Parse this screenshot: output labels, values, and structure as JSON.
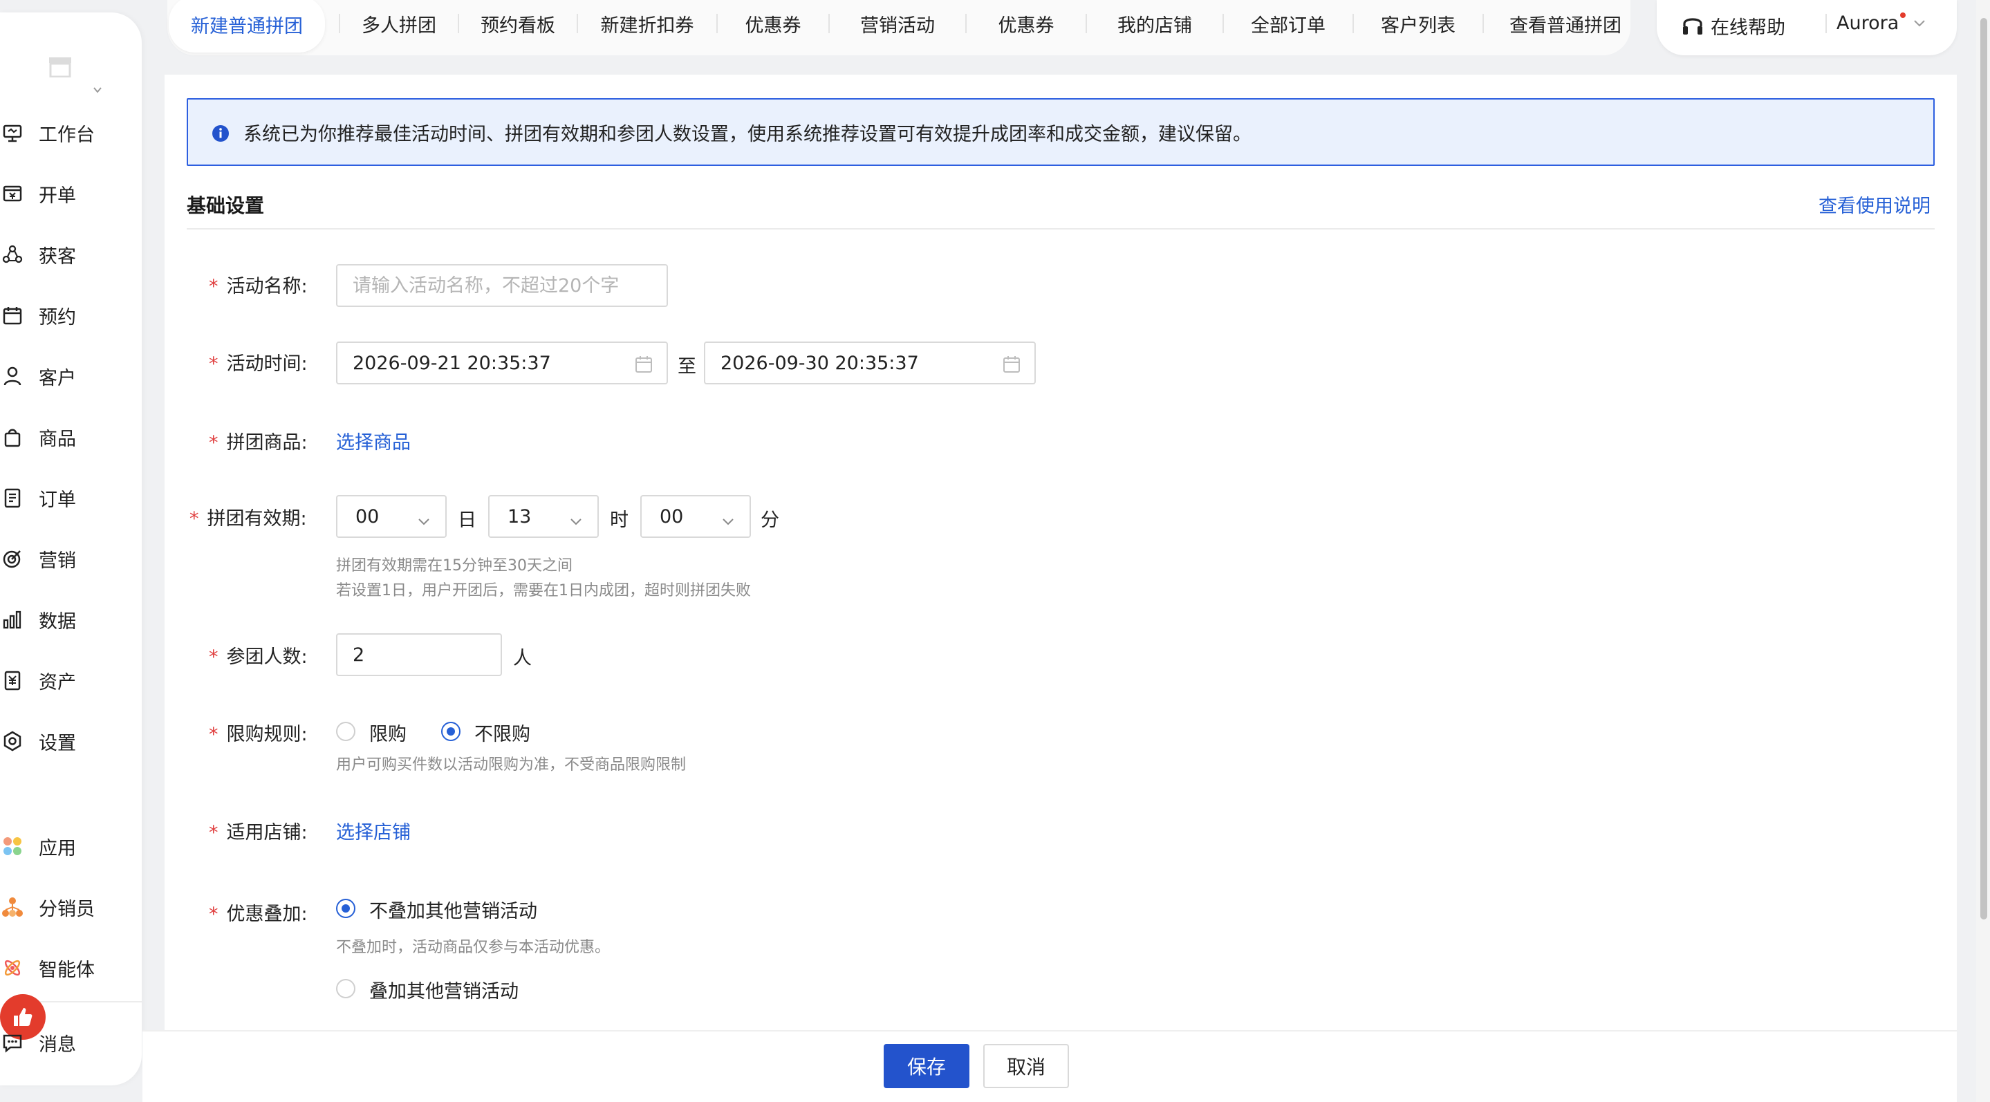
{
  "sidebar": {
    "items": [
      {
        "label": "工作台",
        "icon": "workbench-icon"
      },
      {
        "label": "开单",
        "icon": "billing-icon"
      },
      {
        "label": "获客",
        "icon": "acquire-icon"
      },
      {
        "label": "预约",
        "icon": "calendar-icon"
      },
      {
        "label": "客户",
        "icon": "user-icon"
      },
      {
        "label": "商品",
        "icon": "bag-icon"
      },
      {
        "label": "订单",
        "icon": "order-icon"
      },
      {
        "label": "营销",
        "icon": "target-icon"
      },
      {
        "label": "数据",
        "icon": "bar-chart-icon"
      },
      {
        "label": "资产",
        "icon": "asset-icon"
      },
      {
        "label": "设置",
        "icon": "gear-icon"
      }
    ],
    "apps": [
      {
        "label": "应用",
        "icon": "apps-icon"
      },
      {
        "label": "分销员",
        "icon": "distributor-icon"
      },
      {
        "label": "智能体",
        "icon": "agent-icon"
      }
    ],
    "message": {
      "label": "消息",
      "icon": "message-icon"
    }
  },
  "tabs": [
    "新建普通拼团",
    "多人拼团",
    "预约看板",
    "新建折扣券",
    "优惠券",
    "营销活动",
    "优惠券",
    "我的店铺",
    "全部订单",
    "客户列表",
    "查看普通拼团"
  ],
  "header": {
    "help_label": "在线帮助",
    "user_name": "Aurora"
  },
  "banner": {
    "text": "系统已为你推荐最佳活动时间、拼团有效期和参团人数设置，使用系统推荐设置可有效提升成团率和成交金额，建议保留。"
  },
  "section": {
    "title": "基础设置",
    "help_link": "查看使用说明"
  },
  "form": {
    "required_mark": "*",
    "activity_name": {
      "label": "活动名称:",
      "placeholder": "请输入活动名称，不超过20个字",
      "value": ""
    },
    "activity_time": {
      "label": "活动时间:",
      "start": "2026-09-21 20:35:37",
      "separator": "至",
      "end": "2026-09-30 20:35:37"
    },
    "product": {
      "label": "拼团商品:",
      "link": "选择商品"
    },
    "validity": {
      "label": "拼团有效期:",
      "day": "00",
      "day_unit": "日",
      "hour": "13",
      "hour_unit": "时",
      "minute": "00",
      "minute_unit": "分",
      "hint1": "拼团有效期需在15分钟至30天之间",
      "hint2": "若设置1日，用户开团后，需要在1日内成团，超时则拼团失败"
    },
    "group_size": {
      "label": "参团人数:",
      "value": "2",
      "unit": "人"
    },
    "limit_rule": {
      "label": "限购规则:",
      "option_limit": "限购",
      "option_unlimited": "不限购",
      "selected": "不限购",
      "hint": "用户可购买件数以活动限购为准，不受商品限购限制"
    },
    "store": {
      "label": "适用店铺:",
      "link": "选择店铺"
    },
    "stacking": {
      "label": "优惠叠加:",
      "option_no": "不叠加其他营销活动",
      "option_no_hint": "不叠加时，活动商品仅参与本活动优惠。",
      "option_yes": "叠加其他营销活动",
      "selected": "不叠加其他营销活动"
    }
  },
  "footer": {
    "save_label": "保存",
    "cancel_label": "取消"
  },
  "colors": {
    "accent": "#2660d6",
    "primary_button": "#2353cc",
    "required": "#e04040",
    "banner_bg": "#eaf1fd",
    "banner_border": "#2d5fe0"
  }
}
